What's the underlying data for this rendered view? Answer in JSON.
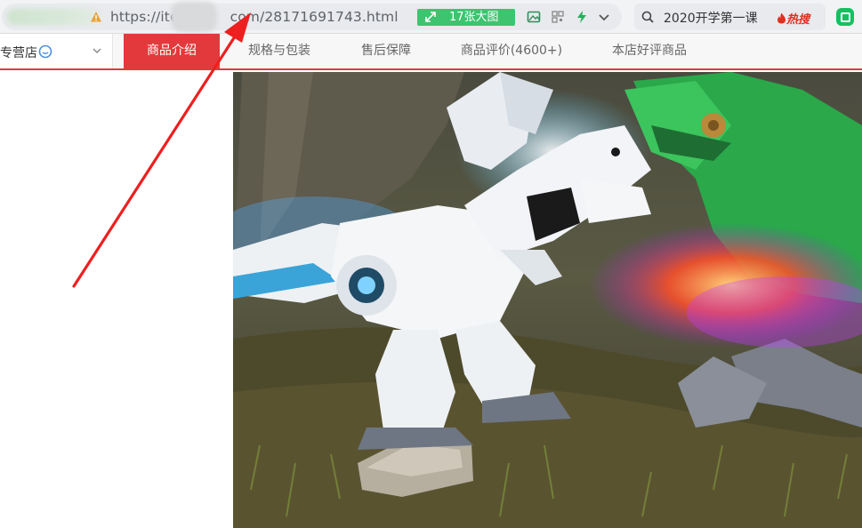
{
  "browser": {
    "url_prefix": "https://ite",
    "url_suffix": "com/28171691743.html",
    "image_count_button": "17张大图",
    "search_query": "2020开学第一课",
    "hot_label": "热搜"
  },
  "store": {
    "name": "专营店"
  },
  "tabs": [
    {
      "label": "商品介绍",
      "active": true
    },
    {
      "label": "规格与包装",
      "active": false
    },
    {
      "label": "售后保障",
      "active": false
    },
    {
      "label": "商品评价(4600+)",
      "active": false
    },
    {
      "label": "本店好评商品",
      "active": false
    }
  ],
  "product_image": {
    "subject": "white robot dinosaur toy and green robot dinosaur toy breathing flame-colored mist on grass"
  },
  "colors": {
    "accent_red": "#e4393c",
    "green_button": "#3ec36f",
    "annotation_arrow": "#ee1f1f"
  }
}
